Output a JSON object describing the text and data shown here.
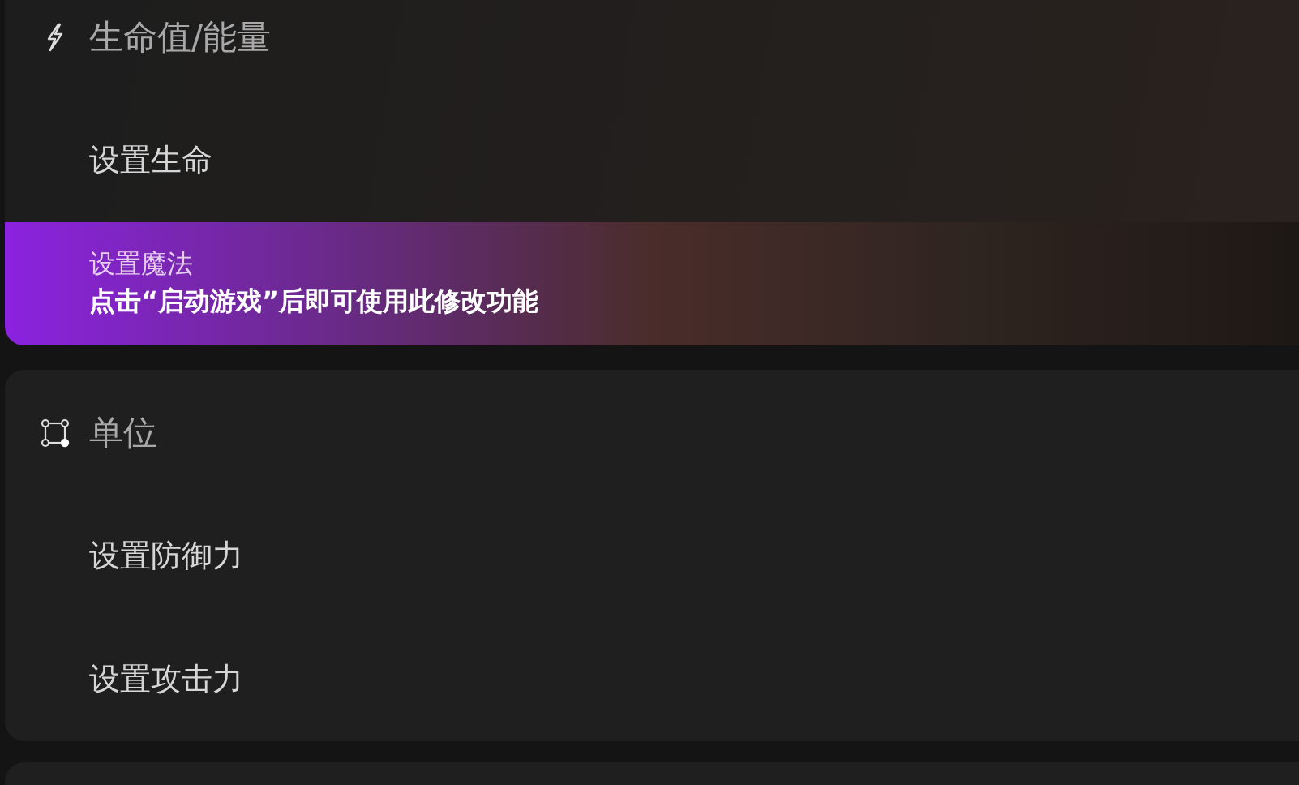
{
  "sections": [
    {
      "kind": "energy",
      "title": "生命值/能量",
      "items": [
        {
          "label": "设置生命",
          "selected": false
        },
        {
          "label": "设置魔法",
          "selected": true,
          "hint": "点击“启动游戏”后即可使用此修改功能"
        }
      ]
    },
    {
      "kind": "units",
      "title": "单位",
      "items": [
        {
          "label": "设置防御力",
          "selected": false
        },
        {
          "label": "设置攻击力",
          "selected": false
        }
      ]
    },
    {
      "kind": "collapsed"
    }
  ]
}
